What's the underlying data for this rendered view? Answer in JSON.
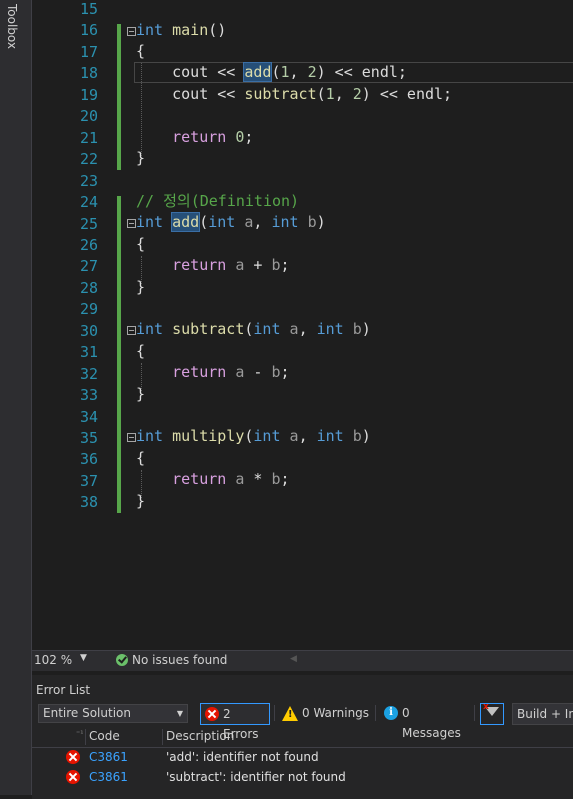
{
  "toolbox": {
    "label": "Toolbox"
  },
  "editor": {
    "lines": [
      15,
      16,
      17,
      18,
      19,
      20,
      21,
      22,
      23,
      24,
      25,
      26,
      27,
      28,
      29,
      30,
      31,
      32,
      33,
      34,
      35,
      36,
      37,
      38
    ],
    "code": {
      "l16_kw": "int",
      "l16_fn": "main",
      "l16_rest": "()",
      "brace_open": "{",
      "brace_close": "}",
      "l18_a": "cout << ",
      "l18_fn": "add",
      "l18_b": "(",
      "l18_n1": "1",
      "l18_c": ", ",
      "l18_n2": "2",
      "l18_d": ") << endl;",
      "l19_a": "cout << ",
      "l19_fn": "subtract",
      "l19_b": "(",
      "l19_n1": "1",
      "l19_c": ", ",
      "l19_n2": "2",
      "l19_d": ") << endl;",
      "l21_ret": "return",
      "l21_num": "0",
      "l21_end": ";",
      "l24_cmt": "// 정의(Definition)",
      "l25_kw": "int",
      "l25_fn": "add",
      "l25_p1": "(",
      "l25_kw2": "int",
      "l25_a": "a",
      "l25_comma": ", ",
      "l25_kw3": "int",
      "l25_b": "b",
      "l25_p2": ")",
      "l27_ret": "return",
      "l27_a": "a",
      "l27_op": " + ",
      "l27_b": "b",
      "l27_end": ";",
      "l30_kw": "int",
      "l30_fn": "subtract",
      "l30_p1": "(",
      "l30_kw2": "int",
      "l30_a": "a",
      "l30_comma": ", ",
      "l30_kw3": "int",
      "l30_b": "b",
      "l30_p2": ")",
      "l32_ret": "return",
      "l32_a": "a",
      "l32_op": " - ",
      "l32_b": "b",
      "l32_end": ";",
      "l35_kw": "int",
      "l35_fn": "multiply",
      "l35_p1": "(",
      "l35_kw2": "int",
      "l35_a": "a",
      "l35_comma": ", ",
      "l35_kw3": "int",
      "l35_b": "b",
      "l35_p2": ")",
      "l37_ret": "return",
      "l37_a": "a",
      "l37_op": " * ",
      "l37_b": "b",
      "l37_end": ";"
    }
  },
  "statusbar": {
    "zoom": "102 %",
    "issues": "No issues found"
  },
  "error_list": {
    "title": "Error List",
    "scope": "Entire Solution",
    "errors_btn": "2 Errors",
    "warnings_btn": "0 Warnings",
    "messages_btn": "0 Messages",
    "build_btn": "Build + Inf",
    "columns": {
      "code": "Code",
      "description": "Description"
    },
    "rows": [
      {
        "code": "C3861",
        "description": "'add': identifier not found"
      },
      {
        "code": "C3861",
        "description": "'subtract': identifier not found"
      }
    ]
  },
  "colors": {
    "keyword": "#569cd6",
    "function": "#dcdcaa",
    "control": "#d8a0df",
    "comment": "#57a64a",
    "line_number": "#2b91af"
  }
}
